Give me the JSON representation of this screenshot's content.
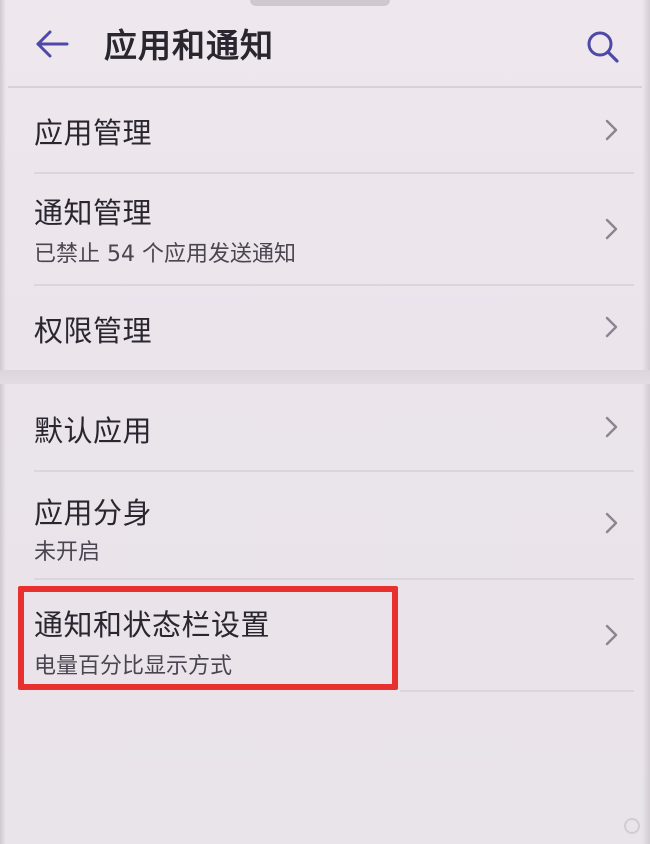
{
  "app_bar": {
    "title": "应用和通知"
  },
  "icons": {
    "back": "arrow-left-icon",
    "search": "search-icon",
    "chevron": "chevron-right-icon"
  },
  "colors": {
    "background": "#ece6ec",
    "accent_icon": "#4e49a6",
    "highlight_border": "#e8312f",
    "title_text": "#2a2630",
    "subtitle_text": "#4a4550"
  },
  "list": {
    "items": [
      {
        "title": "应用管理"
      },
      {
        "title": "通知管理",
        "subtitle": "已禁止 54 个应用发送通知"
      },
      {
        "title": "权限管理"
      },
      {
        "title": "默认应用"
      },
      {
        "title": "应用分身",
        "subtitle": "未开启"
      },
      {
        "title": "通知和状态栏设置",
        "subtitle": "电量百分比显示方式"
      }
    ]
  }
}
